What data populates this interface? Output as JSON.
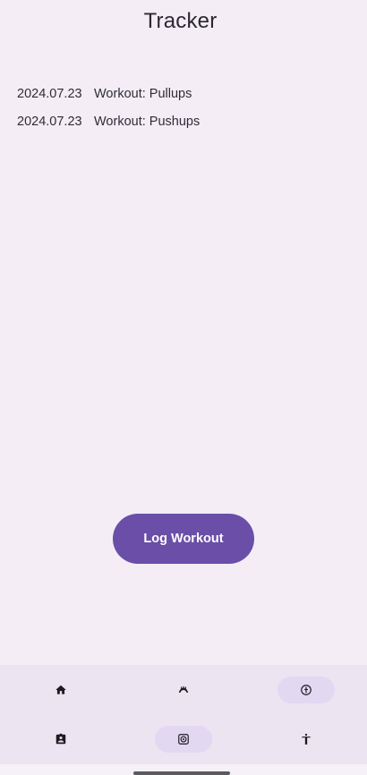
{
  "app": {
    "title": "Tracker"
  },
  "logs": [
    {
      "date": "2024.07.23",
      "entry": "Workout: Pullups"
    },
    {
      "date": "2024.07.23",
      "entry": "Workout: Pushups"
    }
  ],
  "actions": {
    "log_workout_label": "Log Workout"
  },
  "nav": {
    "row1": [
      {
        "icon": "home-icon",
        "active": false
      },
      {
        "icon": "dumbbell-icon",
        "active": false
      },
      {
        "icon": "info-icon",
        "active": true
      }
    ],
    "row2": [
      {
        "icon": "assignment-ind-icon",
        "active": false
      },
      {
        "icon": "target-icon",
        "active": true
      },
      {
        "icon": "accessibility-icon",
        "active": false
      }
    ]
  },
  "colors": {
    "background": "#f4edf6",
    "accent": "#6a4ea8",
    "nav_background": "#ece4f1",
    "active_pill": "#e3d8f2"
  }
}
